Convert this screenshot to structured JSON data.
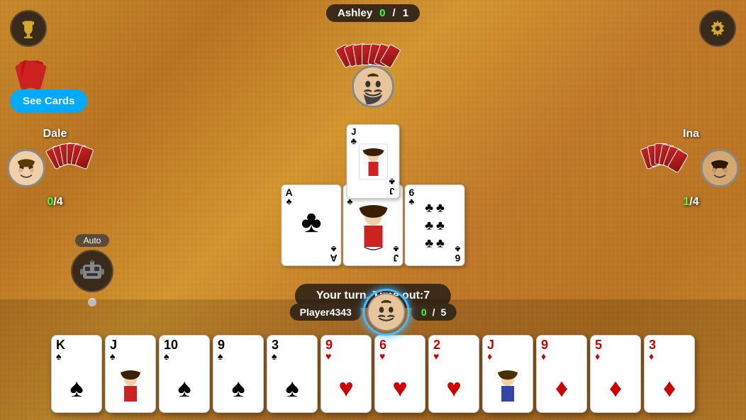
{
  "table": {
    "background": "wood"
  },
  "buttons": {
    "trophy": "🏆",
    "settings": "⚙",
    "see_cards": "See Cards"
  },
  "players": {
    "top": {
      "name": "Ashley",
      "score_current": "0",
      "score_total": "1",
      "avatar": "mustache_man"
    },
    "left": {
      "name": "Dale",
      "score_current": "0",
      "score_total": "4",
      "avatar": "young_man"
    },
    "right": {
      "name": "Ina",
      "score_current": "1",
      "score_total": "4",
      "avatar": "man_color"
    },
    "bottom": {
      "name": "Player4343",
      "score_current": "0",
      "score_total": "5",
      "avatar": "mustache_man2"
    }
  },
  "center_cards": [
    {
      "rank": "J",
      "suit": "♣",
      "suit_color": "black"
    },
    {
      "rank": "A",
      "suit": "♣",
      "suit_color": "black"
    },
    {
      "rank": "J",
      "suit": "♣",
      "suit_color": "black"
    },
    {
      "rank": "6",
      "suit": "♣",
      "suit_color": "black"
    }
  ],
  "turn_message": "Your turn, Time out:7",
  "auto_label": "Auto",
  "hand_cards": [
    {
      "rank": "K",
      "suit": "♠",
      "suit_color": "black"
    },
    {
      "rank": "J",
      "suit": "♠",
      "suit_color": "black"
    },
    {
      "rank": "10",
      "suit": "♠",
      "suit_color": "black"
    },
    {
      "rank": "9",
      "suit": "♠",
      "suit_color": "black"
    },
    {
      "rank": "3",
      "suit": "♠",
      "suit_color": "black"
    },
    {
      "rank": "9",
      "suit": "♥",
      "suit_color": "red"
    },
    {
      "rank": "6",
      "suit": "♥",
      "suit_color": "red"
    },
    {
      "rank": "2",
      "suit": "♥",
      "suit_color": "red"
    },
    {
      "rank": "J",
      "suit": "♦",
      "suit_color": "red"
    },
    {
      "rank": "9",
      "suit": "♦",
      "suit_color": "red"
    },
    {
      "rank": "5",
      "suit": "♦",
      "suit_color": "red"
    },
    {
      "rank": "3",
      "suit": "♦",
      "suit_color": "red"
    }
  ]
}
